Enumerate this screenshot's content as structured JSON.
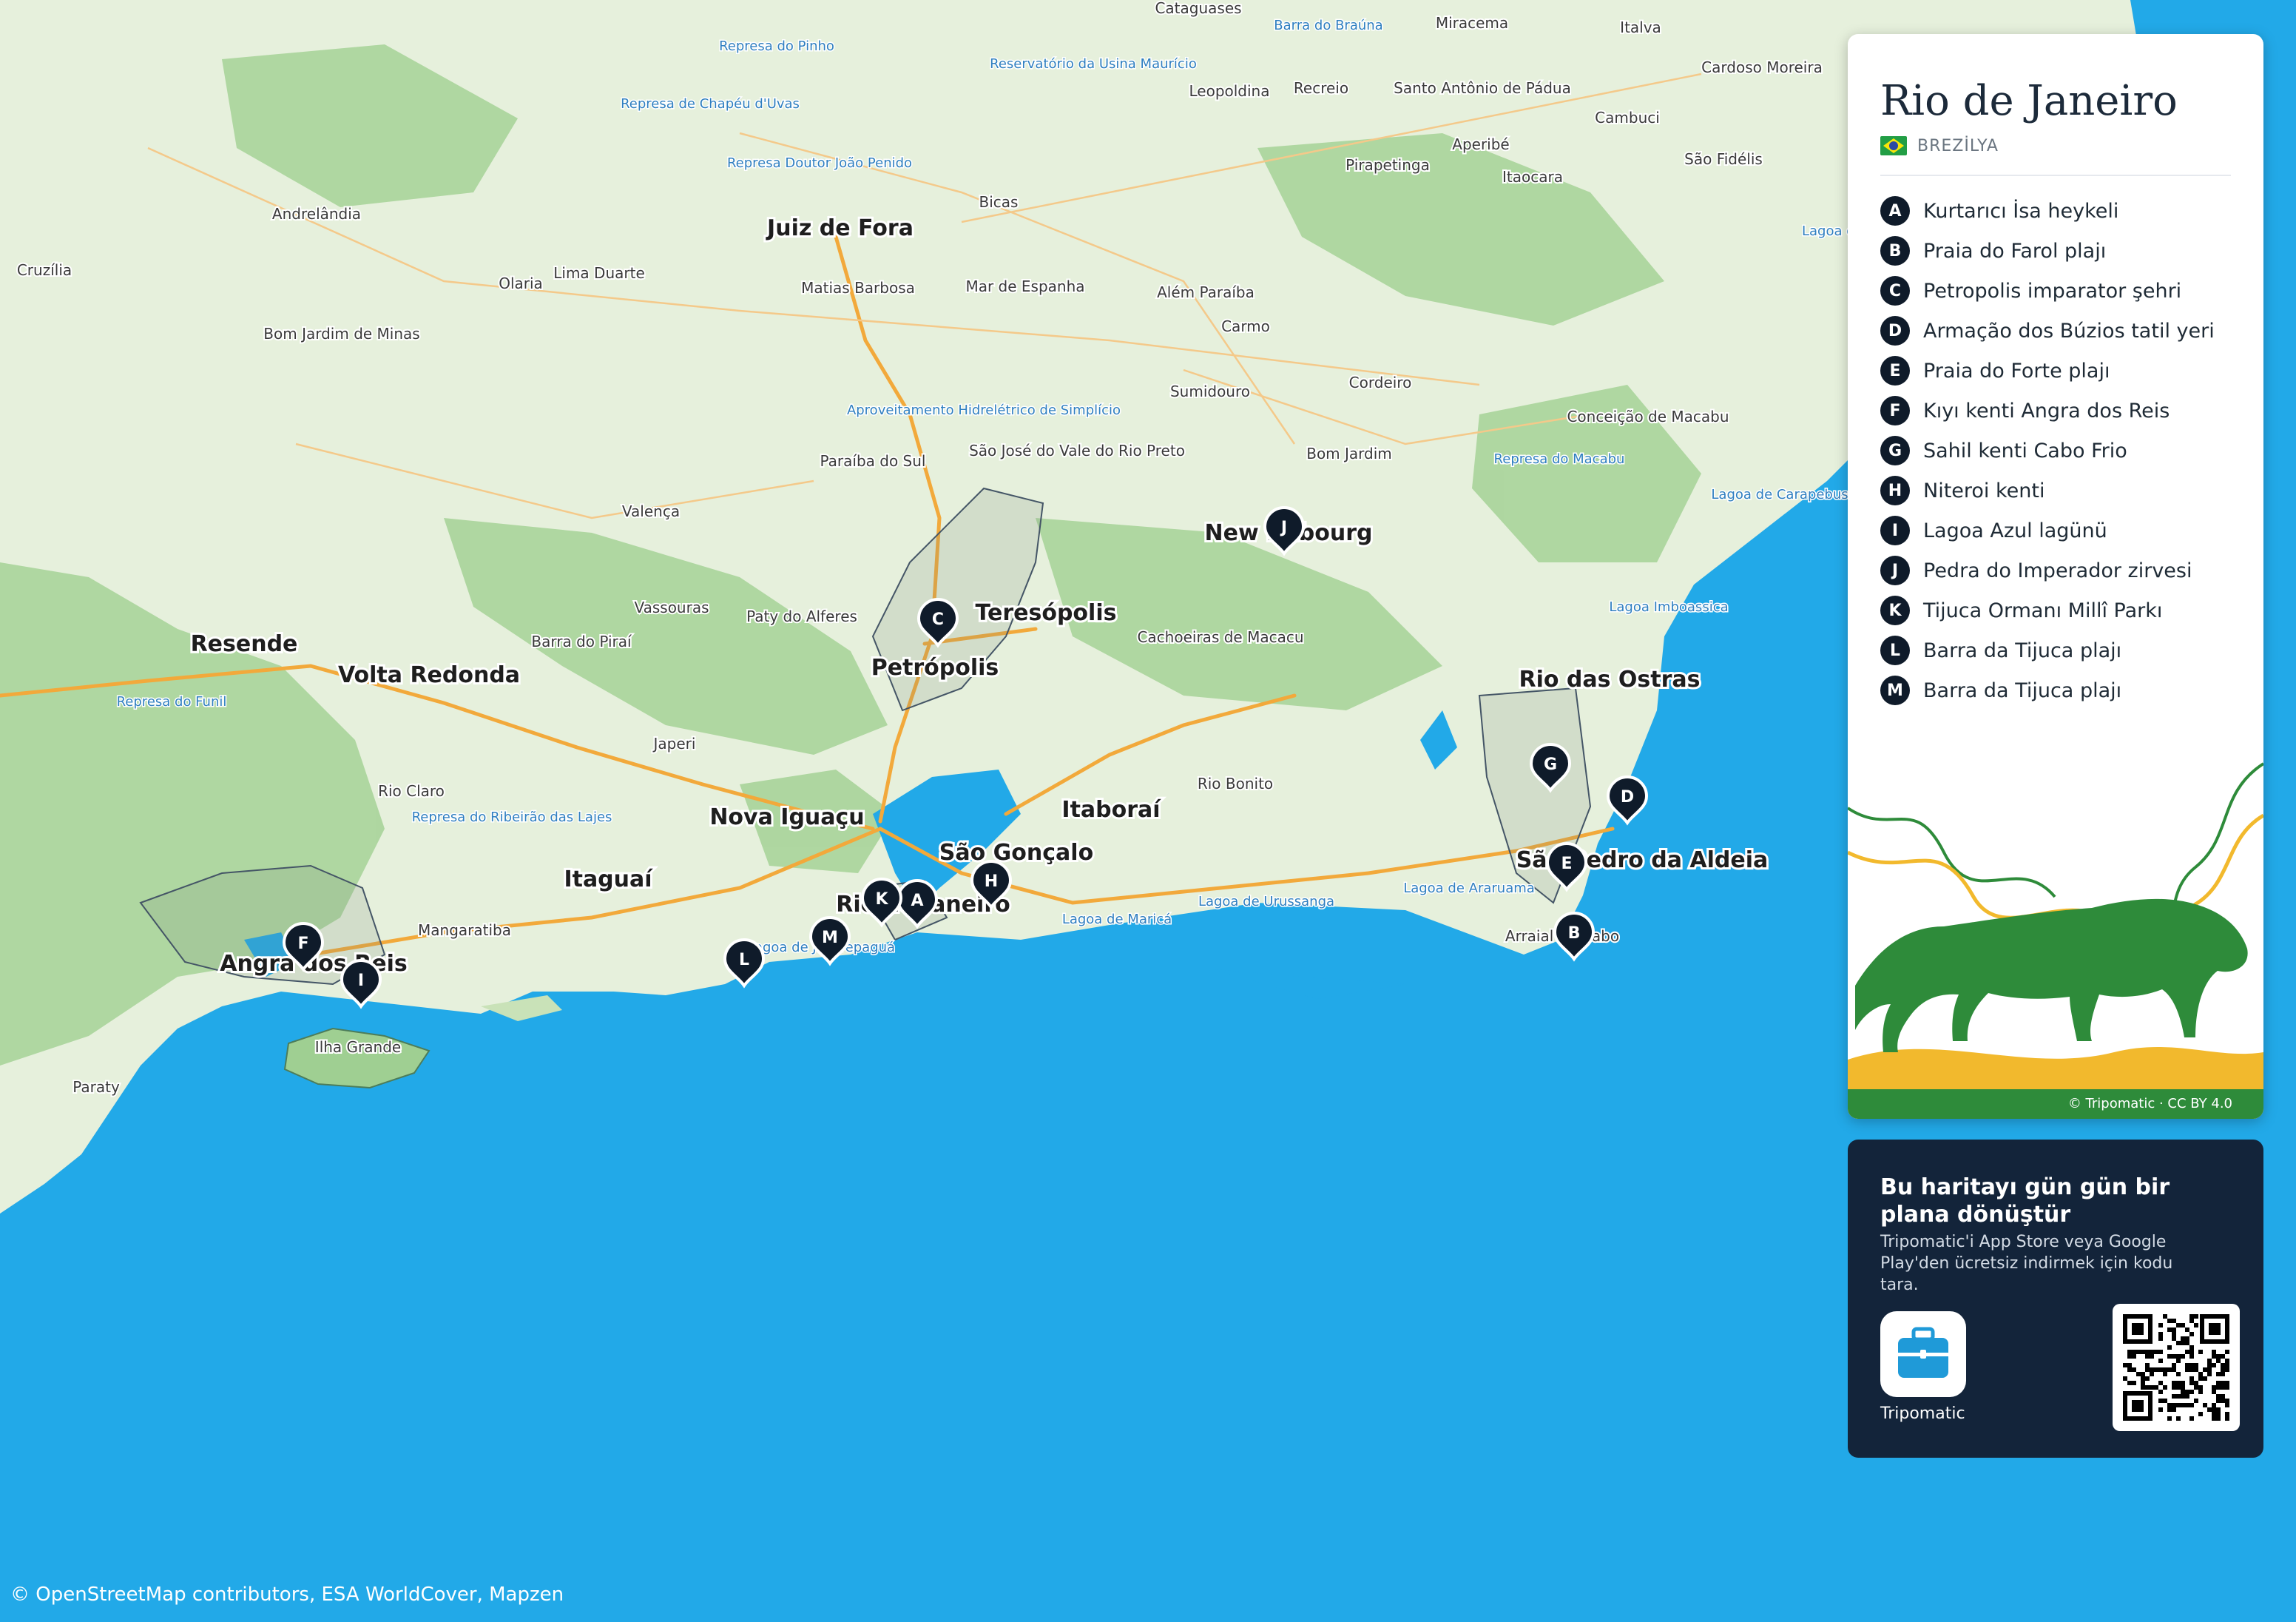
{
  "map": {
    "cities": [
      {
        "name": "Juiz de Fora"
      },
      {
        "name": "Resende"
      },
      {
        "name": "Volta Redonda"
      },
      {
        "name": "Petrópolis"
      },
      {
        "name": "Teresópolis"
      },
      {
        "name": "New Fribourg"
      },
      {
        "name": "Nova Iguaçu"
      },
      {
        "name": "São Gonçalo"
      },
      {
        "name": "Itaboraí"
      },
      {
        "name": "Itaguaí"
      },
      {
        "name": "Angra dos Reis"
      },
      {
        "name": "Rio das Ostras"
      },
      {
        "name": "São Pedro da Aldeia"
      },
      {
        "name": "Rio de Janeiro"
      }
    ],
    "towns": [
      {
        "name": "Cataguases"
      },
      {
        "name": "Miracema"
      },
      {
        "name": "Italva"
      },
      {
        "name": "Cardoso Moreira"
      },
      {
        "name": "Leopoldina"
      },
      {
        "name": "Recreio"
      },
      {
        "name": "Santo Antônio de Pádua"
      },
      {
        "name": "Cambuci"
      },
      {
        "name": "Andrelândia"
      },
      {
        "name": "Aperibé"
      },
      {
        "name": "São Fidélis"
      },
      {
        "name": "Pirapetinga"
      },
      {
        "name": "Itaocara"
      },
      {
        "name": "Bicas"
      },
      {
        "name": "Cruzília"
      },
      {
        "name": "Olaria"
      },
      {
        "name": "Lima Duarte"
      },
      {
        "name": "Matias Barbosa"
      },
      {
        "name": "Mar de Espanha"
      },
      {
        "name": "Além Paraíba"
      },
      {
        "name": "Carmo"
      },
      {
        "name": "Bom Jardim de Minas"
      },
      {
        "name": "Sumidouro"
      },
      {
        "name": "Cordeiro"
      },
      {
        "name": "Conceição de Macabu"
      },
      {
        "name": "São José do Vale do Rio Preto"
      },
      {
        "name": "Paraíba do Sul"
      },
      {
        "name": "Bom Jardim"
      },
      {
        "name": "Valença"
      },
      {
        "name": "Vassouras"
      },
      {
        "name": "Paty do Alferes"
      },
      {
        "name": "Barra do Piraí"
      },
      {
        "name": "Cachoeiras de Macacu"
      },
      {
        "name": "Japeri"
      },
      {
        "name": "Rio Claro"
      },
      {
        "name": "Rio Bonito"
      },
      {
        "name": "Mangaratiba"
      },
      {
        "name": "Ilha Grande"
      },
      {
        "name": "Paraty"
      },
      {
        "name": "Arraial do Cabo"
      }
    ],
    "water": [
      {
        "name": "Represa do Pinho"
      },
      {
        "name": "Barra do Braúna"
      },
      {
        "name": "Reservatório da Usina Maurício"
      },
      {
        "name": "Represa de Chapéu d'Uvas"
      },
      {
        "name": "Represa Doutor João Penido"
      },
      {
        "name": "Aproveitamento Hidrelétrico de Simplício"
      },
      {
        "name": "Represa do Funil"
      },
      {
        "name": "Represa do Ribeirão das Lajes"
      },
      {
        "name": "Lagoa Imboassica"
      },
      {
        "name": "Represa do Macabu"
      },
      {
        "name": "Lagoa de Carapebus"
      },
      {
        "name": "Lagoa de Araruama"
      },
      {
        "name": "Lagoa de Maricá"
      },
      {
        "name": "Lagoa de Urussanga"
      },
      {
        "name": "Lagoa do Campelo"
      },
      {
        "name": "Lagoa de Jacarepaguá"
      }
    ],
    "markers": [
      {
        "letter": "A"
      },
      {
        "letter": "B"
      },
      {
        "letter": "C"
      },
      {
        "letter": "D"
      },
      {
        "letter": "E"
      },
      {
        "letter": "F"
      },
      {
        "letter": "G"
      },
      {
        "letter": "H"
      },
      {
        "letter": "I"
      },
      {
        "letter": "J"
      },
      {
        "letter": "K"
      },
      {
        "letter": "L"
      },
      {
        "letter": "M"
      }
    ],
    "colors": {
      "sea": "#22a9e8",
      "land": "#e3efd8",
      "forest": "#9fcf92",
      "road": "#f2a93b",
      "marker": "#0f1b2a"
    }
  },
  "panel": {
    "title": "Rio de Janeiro",
    "country": "BREZİLYA",
    "flag_icon": "brazil-flag-icon",
    "pois": [
      {
        "letter": "A",
        "name": "Kurtarıcı İsa heykeli"
      },
      {
        "letter": "B",
        "name": "Praia do Farol plajı"
      },
      {
        "letter": "C",
        "name": "Petropolis imparator şehri"
      },
      {
        "letter": "D",
        "name": "Armação dos Búzios tatil yeri"
      },
      {
        "letter": "E",
        "name": "Praia do Forte plajı"
      },
      {
        "letter": "F",
        "name": "Kıyı kenti Angra dos Reis"
      },
      {
        "letter": "G",
        "name": "Sahil kenti Cabo Frio"
      },
      {
        "letter": "H",
        "name": "Niteroi kenti"
      },
      {
        "letter": "I",
        "name": "Lagoa Azul lagünü"
      },
      {
        "letter": "J",
        "name": "Pedra do Imperador zirvesi"
      },
      {
        "letter": "K",
        "name": "Tijuca Ormanı Millî Parkı"
      },
      {
        "letter": "L",
        "name": "Barra da Tijuca plajı"
      },
      {
        "letter": "M",
        "name": "Barra da Tijuca plajı"
      }
    ],
    "credit": "© Tripomatic · CC BY 4.0",
    "art_colors": {
      "green": "#2e8b3a",
      "yellow": "#f2b92d"
    }
  },
  "promo": {
    "title": "Bu haritayı gün gün bir plana dönüştür",
    "text": "Tripomatic'i App Store veya Google Play'den ücretsiz indirmek için kodu tara.",
    "app_name": "Tripomatic",
    "app_icon": "suitcase-icon",
    "qr_icon": "qr-code-icon"
  },
  "attribution": "© OpenStreetMap contributors, ESA WorldCover, Mapzen"
}
